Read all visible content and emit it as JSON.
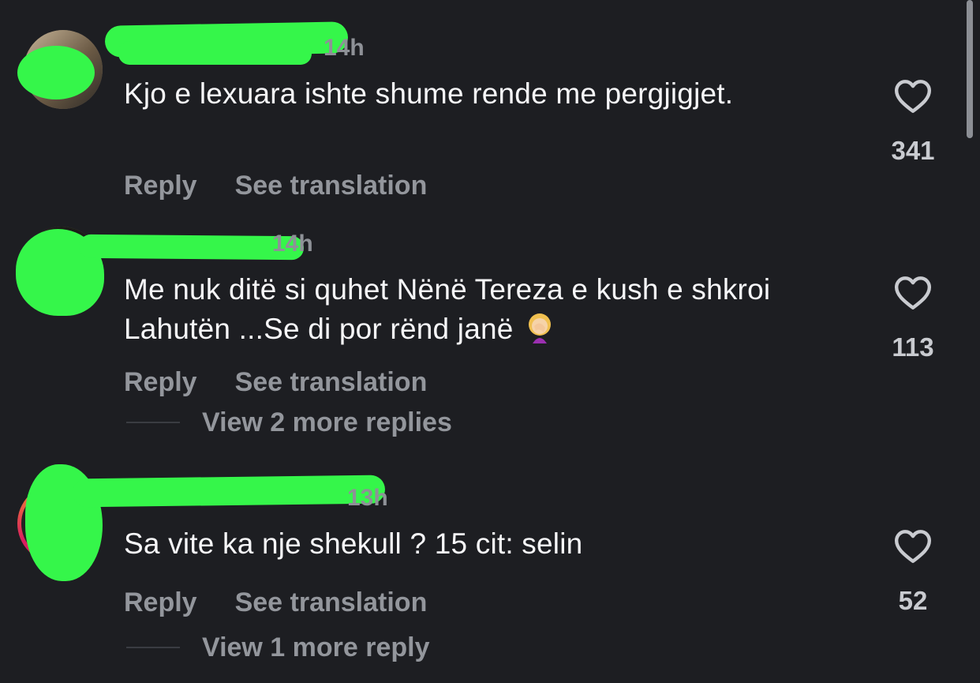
{
  "comments": [
    {
      "time": "14h",
      "text": "Kjo e lexuara ishte shume rende me pergjigjet.",
      "reply_label": "Reply",
      "translate_label": "See translation",
      "likes": "341"
    },
    {
      "time": "14h",
      "text": "Me nuk ditë si quhet Nënë Tereza e kush e shkroi Lahutën ...Se di por rënd janë",
      "emoji": "🤦‍♀️",
      "reply_label": "Reply",
      "translate_label": "See translation",
      "view_more": "View 2 more replies",
      "likes": "113"
    },
    {
      "time": "13h",
      "text": "Sa vite ka nje shekull ? 15 cit: selin",
      "reply_label": "Reply",
      "translate_label": "See translation",
      "view_more": "View 1 more reply",
      "likes": "52"
    }
  ],
  "icons": {
    "like": "heart-outline-icon",
    "emoji": "woman-facepalming"
  },
  "colors": {
    "background": "#1d1e22",
    "text": "#f6f6f8",
    "muted": "#93969c",
    "redaction": "#35f64a"
  }
}
